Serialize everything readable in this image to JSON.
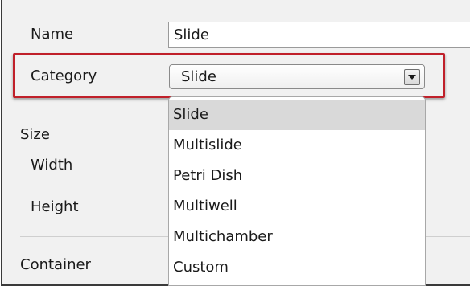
{
  "labels": {
    "name": "Name",
    "category": "Category",
    "size": "Size",
    "width": "Width",
    "height": "Height",
    "container": "Container"
  },
  "name_field": {
    "value": "Slide"
  },
  "category_combo": {
    "value": "Slide",
    "arrow_icon": "chevron-down-icon"
  },
  "dropdown": {
    "options": [
      "Slide",
      "Multislide",
      "Petri Dish",
      "Multiwell",
      "Multichamber",
      "Custom"
    ],
    "selected": "Slide"
  },
  "colors": {
    "highlight_border": "#c0202a",
    "panel_background": "#f1f1f1",
    "selected_option": "#d9d9d9"
  }
}
